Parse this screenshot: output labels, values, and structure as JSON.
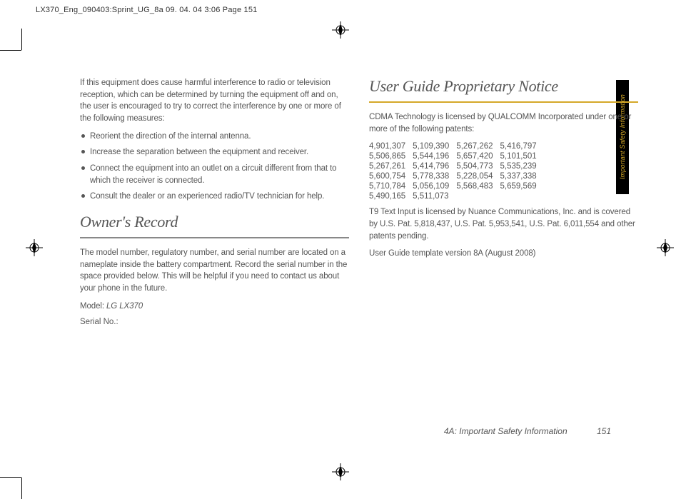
{
  "header": {
    "slug": "LX370_Eng_090403:Sprint_UG_8a  09. 04. 04      3:06  Page 151"
  },
  "left": {
    "intro": "If this equipment does cause harmful interference to radio or television reception, which can be determined by turning the equipment off and on, the user is encouraged to try to correct the interference by one or more of the following measures:",
    "bullets": [
      "Reorient the direction of the internal antenna.",
      "Increase the separation between the equipment and receiver.",
      "Connect the equipment into an outlet on a circuit different from that to which the receiver is connected.",
      "Consult the dealer or an experienced radio/TV technician for help."
    ],
    "owners_heading": "Owner's Record",
    "owners_body": "The model number, regulatory number, and serial number are located on a nameplate inside the battery compartment. Record the serial number in the space provided below. This will be helpful if you need to contact us about your phone in the future.",
    "model_label": "Model: ",
    "model_value": "LG LX370",
    "serial_label": "Serial No.:"
  },
  "right": {
    "heading": "User Guide Proprietary Notice",
    "cdma_intro": "CDMA Technology is licensed by QUALCOMM Incorporated under one or more of the following patents:",
    "patents": [
      [
        "4,901,307",
        "5,109,390",
        "5,267,262",
        "5,416,797"
      ],
      [
        "5,506,865",
        "5,544,196",
        "5,657,420",
        "5,101,501"
      ],
      [
        "5,267,261",
        "5,414,796",
        "5,504,773",
        "5,535,239"
      ],
      [
        "5,600,754",
        "5,778,338",
        "5,228,054",
        "5,337,338"
      ],
      [
        "5,710,784",
        "5,056,109",
        "5,568,483",
        "5,659,569"
      ],
      [
        "5,490,165",
        "5,511,073",
        "",
        ""
      ]
    ],
    "t9": "T9 Text Input is licensed by Nuance Communications, Inc. and is covered by U.S. Pat. 5,818,437, U.S. Pat. 5,953,541, U.S. Pat. 6,011,554 and other patents pending.",
    "template_version": "User Guide template version 8A (August 2008)"
  },
  "sidetab": {
    "label": "Important Safety Information"
  },
  "footer": {
    "section": "4A: Important Safety Information",
    "page": "151"
  }
}
